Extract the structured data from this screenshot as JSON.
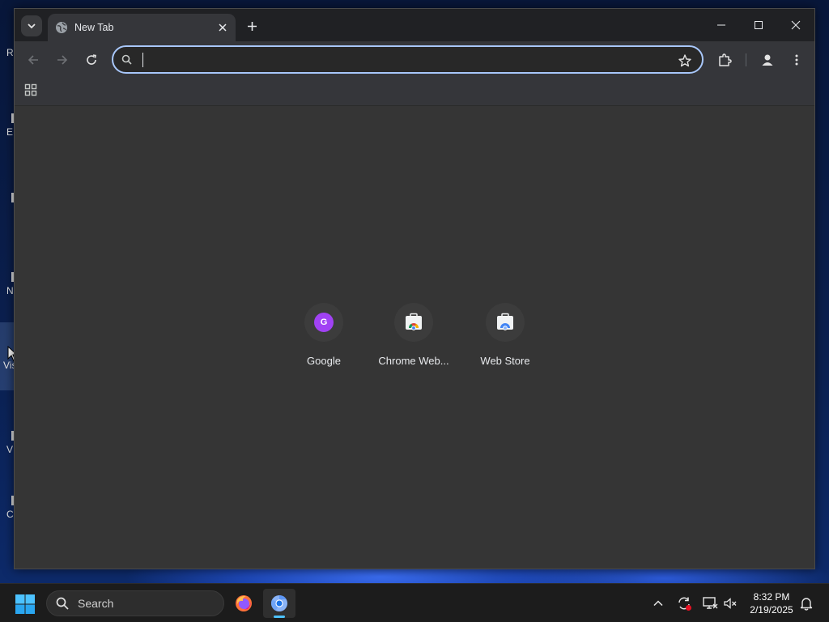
{
  "desktop": {
    "icons": [
      {
        "label": "R"
      },
      {
        "label": "E"
      },
      {
        "label": ""
      },
      {
        "label": "N"
      },
      {
        "label": "Vis"
      },
      {
        "label": "V"
      },
      {
        "label": "C"
      }
    ]
  },
  "browser": {
    "tab": {
      "title": "New Tab"
    },
    "omnibox": {
      "value": "",
      "placeholder": ""
    },
    "shortcuts": [
      {
        "label": "Google",
        "icon": "google-letter-avatar",
        "letter": "G",
        "color": "#a142f4"
      },
      {
        "label": "Chrome Web...",
        "icon": "chrome-web-store-icon"
      },
      {
        "label": "Web Store",
        "icon": "web-store-icon"
      }
    ]
  },
  "taskbar": {
    "search_label": "Search",
    "apps": [
      {
        "name": "firefox-icon"
      },
      {
        "name": "chrome-icon",
        "active": true
      }
    ],
    "clock": {
      "time": "8:32 PM",
      "date": "2/19/2025"
    }
  },
  "colors": {
    "accent": "#a8c7fa",
    "titlebar": "#202124",
    "toolbar": "#35363a",
    "content": "#353535",
    "taskbar": "#1c1c1c"
  }
}
